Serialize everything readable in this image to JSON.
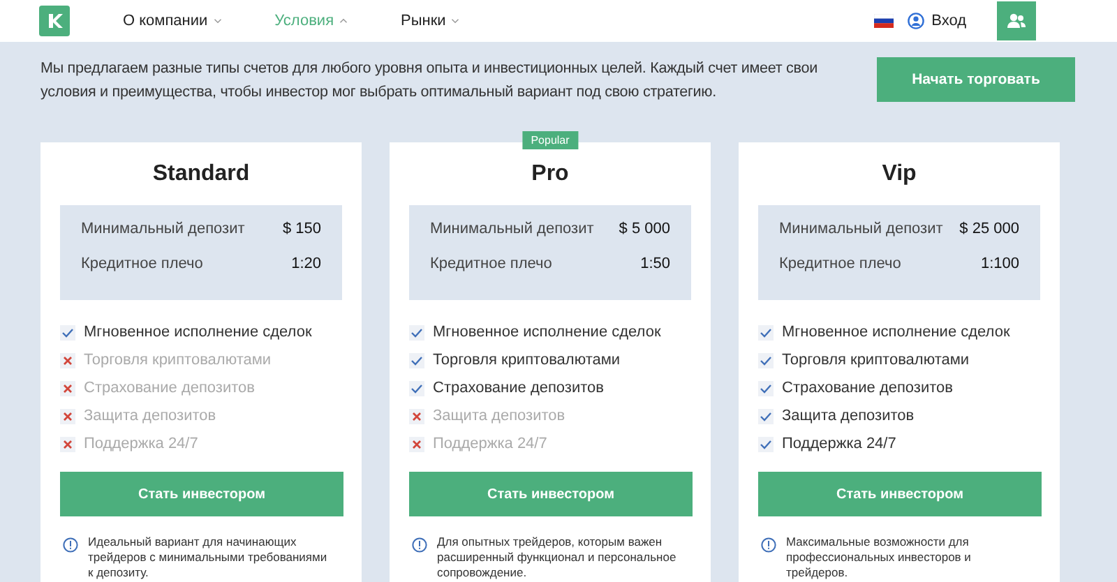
{
  "nav": [
    {
      "label": "О компании",
      "selected": false
    },
    {
      "label": "Условия",
      "selected": true
    },
    {
      "label": "Рынки",
      "selected": false
    }
  ],
  "login": "Вход",
  "intro": "Мы предлагаем разные типы счетов для любого уровня опыта и инвестиционных целей. Каждый счет имеет свои условия и преимущества, чтобы инвестор мог выбрать оптимальный вариант под свою стратегию.",
  "start_button": "Начать торговать",
  "plans": [
    {
      "name": "Standard",
      "terms": [
        {
          "label": "Минимальный депозит",
          "value": "$ 150"
        },
        {
          "label": "Кредитное плечо",
          "value": "1:20"
        }
      ],
      "features": [
        {
          "label": "Мгновенное исполнение сделок",
          "included": true
        },
        {
          "label": "Торговля криптовалютами",
          "included": false
        },
        {
          "label": "Страхование депозитов",
          "included": false
        },
        {
          "label": "Защита депозитов",
          "included": false
        },
        {
          "label": "Поддержка 24/7",
          "included": false
        }
      ],
      "button": "Стать инвестором",
      "note": "Идеальный вариант для начинающих трейдеров с минимальными требованиями к депозиту."
    },
    {
      "name": "Pro",
      "badge": "Popular",
      "terms": [
        {
          "label": "Минимальный депозит",
          "value": "$ 5 000"
        },
        {
          "label": "Кредитное плечо",
          "value": "1:50"
        }
      ],
      "features": [
        {
          "label": "Мгновенное исполнение сделок",
          "included": true
        },
        {
          "label": "Торговля криптовалютами",
          "included": true
        },
        {
          "label": "Страхование депозитов",
          "included": true
        },
        {
          "label": "Защита депозитов",
          "included": false
        },
        {
          "label": "Поддержка 24/7",
          "included": false
        }
      ],
      "button": "Стать инвестором",
      "note": "Для опытных трейдеров, которым важен расширенный функционал и персональное сопровождение."
    },
    {
      "name": "Vip",
      "terms": [
        {
          "label": "Минимальный депозит",
          "value": "$ 25 000"
        },
        {
          "label": "Кредитное плечо",
          "value": "1:100"
        }
      ],
      "features": [
        {
          "label": "Мгновенное исполнение сделок",
          "included": true
        },
        {
          "label": "Торговля криптовалютами",
          "included": true
        },
        {
          "label": "Страхование депозитов",
          "included": true
        },
        {
          "label": "Защита депозитов",
          "included": true
        },
        {
          "label": "Поддержка 24/7",
          "included": true
        }
      ],
      "button": "Стать инвестором",
      "note": "Максимальные возможности для профессиональных инвесторов и трейдеров."
    }
  ]
}
